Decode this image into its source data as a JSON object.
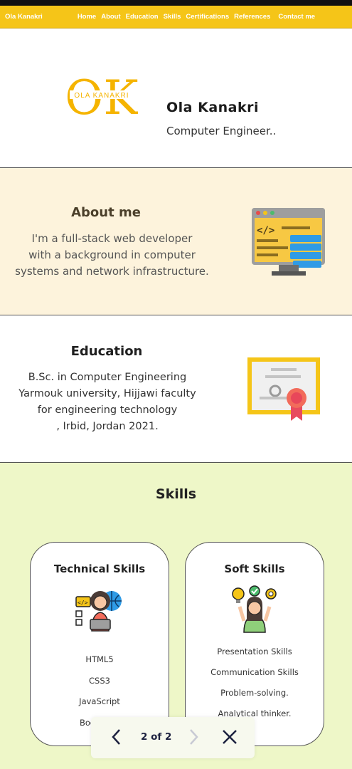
{
  "nav": {
    "brand": "Ola Kanakri",
    "links": [
      "Home",
      "About",
      "Education",
      "Skills",
      "Certifications",
      "References"
    ],
    "contact": "Contact me",
    "color": "#f5c518"
  },
  "hero": {
    "logo_letters": "OK",
    "logo_text": "OLA KANAKRI",
    "name": "Ola Kanakri",
    "title": "Computer Engineer.."
  },
  "about": {
    "heading": "About me",
    "lines": [
      "I'm a full-stack web developer",
      "with a background in computer",
      "systems and network infrastructure."
    ],
    "icon": "web-code-icon"
  },
  "education": {
    "heading": "Education",
    "lines": [
      "B.Sc. in Computer Engineering",
      "Yarmouk university, Hijjawi faculty",
      "for engineering technology",
      ", Irbid, Jordan 2021."
    ],
    "icon": "certificate-icon"
  },
  "skills": {
    "heading": "Skills",
    "technical": {
      "title": "Technical Skills",
      "icon": "developer-icon",
      "items": [
        "HTML5",
        "CSS3",
        "JavaScript",
        "Bootstrap"
      ]
    },
    "soft": {
      "title": "Soft Skills",
      "icon": "idea-person-icon",
      "items": [
        "Presentation Skills",
        "Communication Skills",
        "Problem-solving.",
        "Analytical thinker."
      ]
    }
  },
  "pager": {
    "count": "2 of 2"
  }
}
